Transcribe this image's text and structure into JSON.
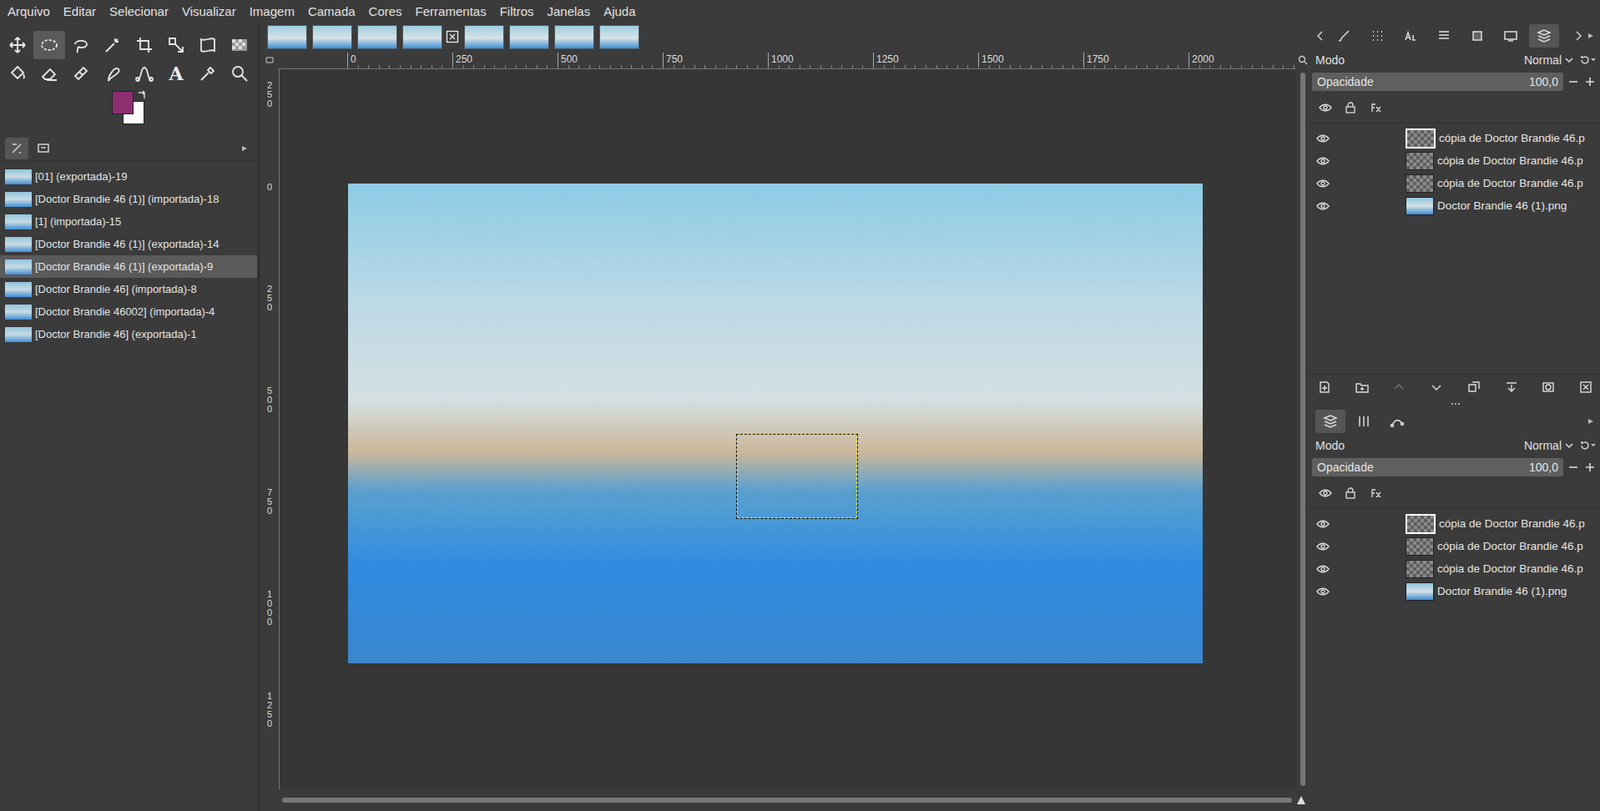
{
  "menu": [
    "Arquivo",
    "Editar",
    "Selecionar",
    "Visualizar",
    "Imagem",
    "Camada",
    "Cores",
    "Ferramentas",
    "Filtros",
    "Janelas",
    "Ajuda"
  ],
  "tools": [
    {
      "kind": "move",
      "selected": false
    },
    {
      "kind": "ellipse-select",
      "selected": true
    },
    {
      "kind": "lasso",
      "selected": false
    },
    {
      "kind": "fuzzy-select",
      "selected": false
    },
    {
      "kind": "crop",
      "selected": false
    },
    {
      "kind": "scale",
      "selected": false
    },
    {
      "kind": "warp",
      "selected": false
    },
    {
      "kind": "gradient",
      "selected": false
    },
    {
      "kind": "bucket",
      "selected": false
    },
    {
      "kind": "eraser",
      "selected": false
    },
    {
      "kind": "heal",
      "selected": false
    },
    {
      "kind": "smudge",
      "selected": false
    },
    {
      "kind": "path",
      "selected": false
    },
    {
      "kind": "text",
      "selected": false,
      "glyph": "A"
    },
    {
      "kind": "picker",
      "selected": false
    },
    {
      "kind": "zoom",
      "selected": false
    }
  ],
  "colors": {
    "foreground": "#8e2f72",
    "background": "#ffffff"
  },
  "left_tabs": [
    {
      "kind": "tool-options",
      "selected": true
    },
    {
      "kind": "device-status",
      "selected": false
    }
  ],
  "images": [
    {
      "label": "[01] (exportada)-19",
      "selected": false
    },
    {
      "label": "[Doctor Brandie 46 (1)] (importada)-18",
      "selected": false
    },
    {
      "label": "[1] (importada)-15",
      "selected": false
    },
    {
      "label": "[Doctor Brandie 46 (1)] (exportada)-14",
      "selected": false
    },
    {
      "label": "[Doctor Brandie 46 (1)] (exportada)-9",
      "selected": true
    },
    {
      "label": "[Doctor Brandie 46] (importada)-8",
      "selected": false
    },
    {
      "label": "[Doctor Brandie 46002] (importada)-4",
      "selected": false
    },
    {
      "label": "[Doctor Brandie 46] (exportada)-1",
      "selected": false
    }
  ],
  "image_tabs": [
    {
      "selected": false
    },
    {
      "selected": false
    },
    {
      "selected": false
    },
    {
      "selected": true
    },
    {
      "selected": false
    },
    {
      "selected": false
    },
    {
      "selected": false
    },
    {
      "selected": false
    }
  ],
  "rulers": {
    "horizontal": [
      "0",
      "250",
      "500",
      "750",
      "1000",
      "1250",
      "1500",
      "1750",
      "2000"
    ],
    "vertical": [
      "250",
      "0",
      "250",
      "500",
      "750",
      "1000",
      "1250"
    ]
  },
  "canvas": {
    "selection_visible": true
  },
  "docks": [
    {
      "tabs": [
        {
          "kind": "brush",
          "selected": false
        },
        {
          "kind": "pattern",
          "selected": false
        },
        {
          "kind": "font",
          "selected": false
        },
        {
          "kind": "gradient",
          "selected": false
        },
        {
          "kind": "palette",
          "selected": false
        },
        {
          "kind": "display",
          "selected": false
        },
        {
          "kind": "layers",
          "selected": true
        }
      ],
      "mode_label": "Modo",
      "mode": "Normal",
      "opacity_label": "Opacidade",
      "opacity": "100,0",
      "opacity_level": 1.0,
      "layers": [
        {
          "name": "cópia de Doctor Brandie 46.p",
          "visible": true,
          "selected": true,
          "kind": "transparent"
        },
        {
          "name": "cópia de Doctor Brandie 46.p",
          "visible": true,
          "selected": false,
          "kind": "transparent"
        },
        {
          "name": "cópia de Doctor Brandie 46.p",
          "visible": true,
          "selected": false,
          "kind": "transparent"
        },
        {
          "name": "Doctor Brandie 46 (1).png",
          "visible": true,
          "selected": false,
          "kind": "image"
        }
      ],
      "buttons": [
        {
          "kind": "new",
          "disabled": false
        },
        {
          "kind": "group",
          "disabled": false
        },
        {
          "kind": "up",
          "disabled": true
        },
        {
          "kind": "down",
          "disabled": false
        },
        {
          "kind": "duplicate",
          "disabled": false
        },
        {
          "kind": "merge",
          "disabled": false
        },
        {
          "kind": "mask",
          "disabled": false
        },
        {
          "kind": "delete",
          "disabled": false
        }
      ]
    },
    {
      "tabs": [
        {
          "kind": "layers",
          "selected": true
        },
        {
          "kind": "channels",
          "selected": false
        },
        {
          "kind": "paths",
          "selected": false
        }
      ],
      "mode_label": "Modo",
      "mode": "Normal",
      "opacity_label": "Opacidade",
      "opacity": "100,0",
      "opacity_level": 1.0,
      "layers": [
        {
          "name": "cópia de Doctor Brandie 46.p",
          "visible": true,
          "selected": true,
          "kind": "transparent"
        },
        {
          "name": "cópia de Doctor Brandie 46.p",
          "visible": true,
          "selected": false,
          "kind": "transparent"
        },
        {
          "name": "cópia de Doctor Brandie 46.p",
          "visible": true,
          "selected": false,
          "kind": "transparent"
        },
        {
          "name": "Doctor Brandie 46 (1).png",
          "visible": true,
          "selected": false,
          "kind": "image"
        }
      ],
      "buttons": []
    }
  ]
}
